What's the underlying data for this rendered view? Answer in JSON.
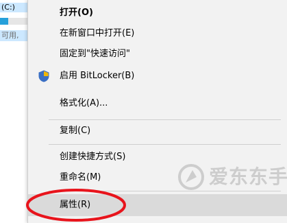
{
  "background_window": {
    "drive_label": "(C:)",
    "free_text": "可用,"
  },
  "context_menu": {
    "items": [
      {
        "label": "打开(O)"
      },
      {
        "label": "在新窗口中打开(E)"
      },
      {
        "label": "固定到\"快速访问\""
      },
      {
        "label": "启用 BitLocker(B)",
        "icon": "shield-icon"
      },
      {
        "label": "格式化(A)..."
      },
      {
        "label": "复制(C)"
      },
      {
        "label": "创建快捷方式(S)"
      },
      {
        "label": "重命名(M)"
      },
      {
        "label": "属性(R)"
      }
    ]
  },
  "watermark": {
    "text": "爱东东手游"
  },
  "annotation": {
    "color": "#e8141c"
  }
}
